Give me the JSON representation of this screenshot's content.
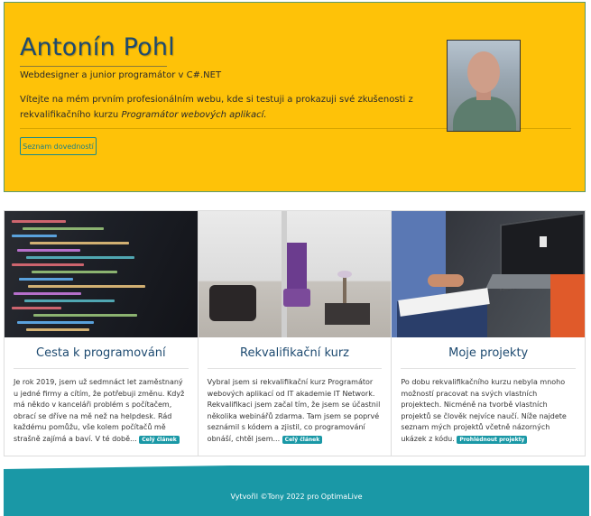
{
  "hero": {
    "title": "Antonín Pohl",
    "subtitle": "Webdesigner a junior programátor v C#.NET",
    "intro_text": "Vítejte na mém prvním profesionálním webu, kde si testuji a prokazuji své zkušenosti z rekvalifikačního kurzu ",
    "intro_emphasis": "Programátor webových aplikací.",
    "button_label": "Seznam dovedností"
  },
  "cards": [
    {
      "title": "Cesta k programování",
      "text": "Je rok 2019, jsem už sedmnáct let zaměstnaný u jedné firmy a cítím, že potřebuji změnu. Když má někdo v kanceláři problém s počítačem, obrací se dříve na mě než na helpdesk. Rád každému pomůžu, vše kolem počítačů mě strašně zajímá a baví. V té době...",
      "badge": "Celý článek"
    },
    {
      "title": "Rekvalifikační kurz",
      "text": "Vybral jsem si rekvalifikační kurz Programátor webových aplikací od IT akademie IT Network. Rekvalifikaci jsem začal tím, že jsem se účastnil několika webinářů zdarma. Tam jsem se poprvé seznámil s kódem a zjistil, co programování obnáší, chtěl jsem...",
      "badge": "Celý článek"
    },
    {
      "title": "Moje projekty",
      "text": "Po dobu rekvalifikačního kurzu nebyla mnoho možností pracovat na svých vlastních projektech. Nicméně na tvorbě vlastních projektů se člověk nejvíce naučí. Níže najdete seznam mých projektů včetně názorných ukázek z kódu.",
      "badge": "Prohlédnout projekty"
    }
  ],
  "footer": {
    "text": "Vytvořil ©Tony 2022 pro OptimaLive"
  },
  "colors": {
    "hero_bg": "#fec208",
    "accent": "#1a98a6",
    "title": "#1d4a70"
  }
}
